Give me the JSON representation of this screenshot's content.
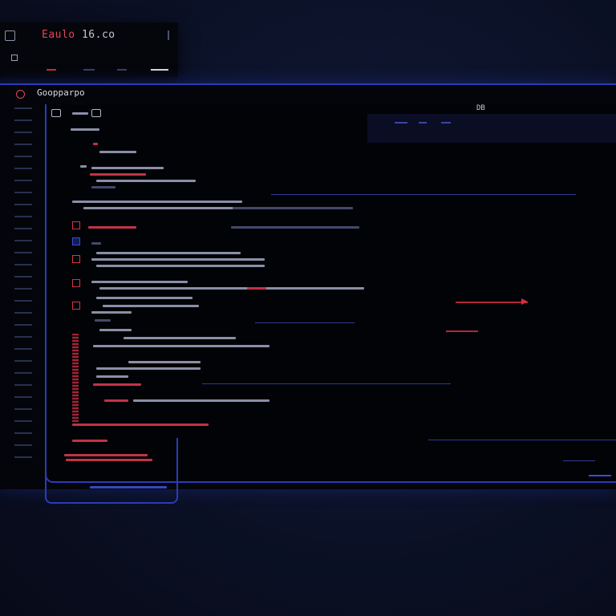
{
  "small_window": {
    "title_accent": "Eaulo",
    "title_rest": " 16.co"
  },
  "main_window": {
    "title": "Goopparpo",
    "header_label": "DB"
  },
  "colors": {
    "background": "#0b1126",
    "accent_blue": "#2a3cb8",
    "accent_red": "#e0455a",
    "editor_bg": "#020307"
  },
  "icons": [
    "app-icon",
    "logo-icon",
    "tab-icon",
    "breakpoint-icon",
    "arrow-icon"
  ]
}
